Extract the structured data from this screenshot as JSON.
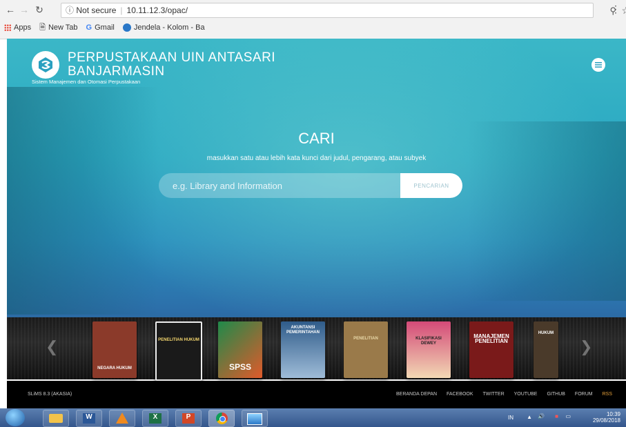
{
  "browser": {
    "security_label": "Not secure",
    "url": "10.11.12.3/opac/",
    "bookmarks": [
      {
        "label": "Apps"
      },
      {
        "label": "New Tab"
      },
      {
        "label": "Gmail"
      },
      {
        "label": "Jendela - Kolom - Ba"
      }
    ]
  },
  "site": {
    "title_line1": "PERPUSTAKAAN UIN ANTASARI",
    "title_line2": "BANJARMASIN",
    "tagline": "Sistem Manajemen dan Otomasi Perpustakaan"
  },
  "search": {
    "heading": "CARI",
    "hint": "masukkan satu atau lebih kata kunci dari judul, pengarang, atau subyek",
    "placeholder": "e.g. Library and Information",
    "button_label": "PENCARIAN"
  },
  "books": [
    {
      "caption": "NEGARA HUKUM",
      "color": "#8b3a2a"
    },
    {
      "caption": "PENELITIAN HUKUM",
      "color": "#1a1a1a"
    },
    {
      "caption": "SPSS",
      "color": "#e05a2b"
    },
    {
      "caption": "AKUNTANSI PEMERINTAHAN",
      "color": "#2f5c8a"
    },
    {
      "caption": "PENELITIAN",
      "color": "#9a7a4a"
    },
    {
      "caption": "KLASIFIKASI DEWEY",
      "color": "#d44a78"
    },
    {
      "caption": "MANAJEMEN PENELITIAN",
      "color": "#7a1a1a"
    },
    {
      "caption": "HUKUM",
      "color": "#4a3a2a"
    }
  ],
  "footer": {
    "version": "SLiMS 8.3 (AKASIA)",
    "links": [
      "BERANDA DEPAN",
      "FACEBOOK",
      "TWITTER",
      "YOUTUBE",
      "GITHUB",
      "FORUM",
      "RSS"
    ]
  },
  "taskbar": {
    "lang": "IN",
    "time": "10:39",
    "date": "29/08/2018"
  }
}
